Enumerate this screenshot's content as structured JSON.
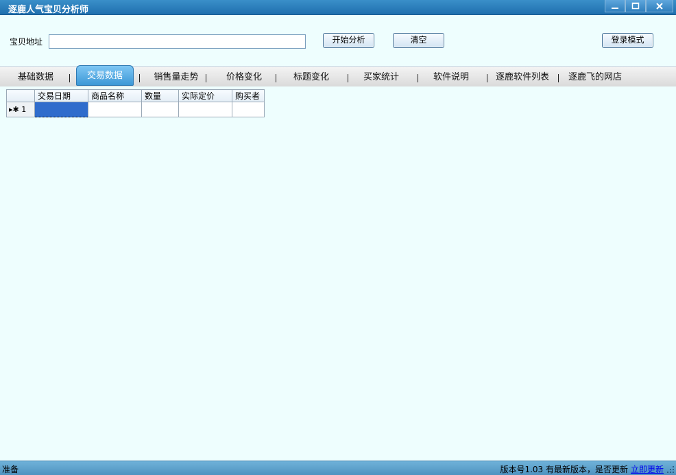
{
  "window": {
    "title": "逐鹿人气宝贝分析师",
    "controls": [
      "minimize-icon",
      "maximize-icon",
      "close-icon"
    ]
  },
  "toolbar": {
    "url_label": "宝贝地址",
    "url_value": "",
    "start_label": "开始分析",
    "clear_label": "清空",
    "login_label": "登录模式"
  },
  "tabs": [
    {
      "label": "基础数据",
      "active": false
    },
    {
      "label": "交易数据",
      "active": true
    },
    {
      "label": "销售量走势",
      "active": false
    },
    {
      "label": "价格变化",
      "active": false
    },
    {
      "label": "标题变化",
      "active": false
    },
    {
      "label": "买家统计",
      "active": false
    },
    {
      "label": "软件说明",
      "active": false
    },
    {
      "label": "逐鹿软件列表",
      "active": false
    },
    {
      "label": "逐鹿飞的网店",
      "active": false
    }
  ],
  "grid": {
    "columns": [
      "交易日期",
      "商品名称",
      "数量",
      "实际定价",
      "购买者"
    ],
    "rows": [
      {
        "header": "▸✱ 1",
        "cells": [
          "",
          "",
          "",
          "",
          ""
        ]
      }
    ]
  },
  "status": {
    "left": "准备",
    "version_text": "版本号1.03 有最新版本，是否更新",
    "update_link": "立即更新"
  },
  "colors": {
    "titlebar": "#2a7fbd",
    "background": "#eefefe",
    "active_tab": "#4ca6e0",
    "statusbar": "#5fa3cd",
    "selected_cell": "#2f6ccc"
  }
}
